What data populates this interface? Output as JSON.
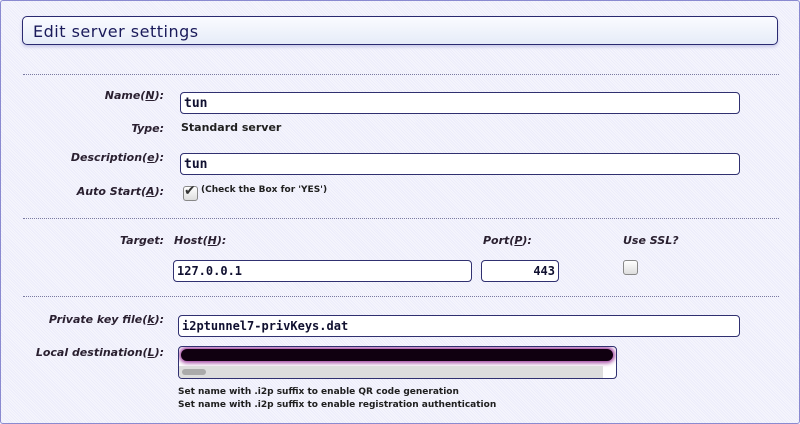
{
  "title": "Edit server settings",
  "name": {
    "label_pre": "Name(",
    "key": "N",
    "label_post": "):",
    "value": "tun"
  },
  "type": {
    "label": "Type:",
    "value": "Standard server"
  },
  "description": {
    "label_pre": "Description(",
    "key": "e",
    "label_post": "):",
    "value": "tun"
  },
  "auto_start": {
    "label_pre": "Auto Start(",
    "key": "A",
    "label_post": "):",
    "checked": true,
    "note": "(Check the Box for 'YES')"
  },
  "target": {
    "label": "Target:",
    "host": {
      "label_pre": "Host(",
      "key": "H",
      "label_post": "):",
      "value": "127.0.0.1"
    },
    "port": {
      "label_pre": "Port(",
      "key": "P",
      "label_post": "):",
      "value": "443"
    },
    "ssl": {
      "label": "Use SSL?",
      "checked": false
    }
  },
  "private_key": {
    "label_pre": "Private key file(",
    "key": "k",
    "label_post": "):",
    "value": "i2ptunnel7-privKeys.dat"
  },
  "local_destination": {
    "label_pre": "Local destination(",
    "key": "L",
    "label_post": "):"
  },
  "hints": [
    "Set name with .i2p suffix to enable QR code generation",
    "Set name with .i2p suffix to enable registration authentication"
  ]
}
